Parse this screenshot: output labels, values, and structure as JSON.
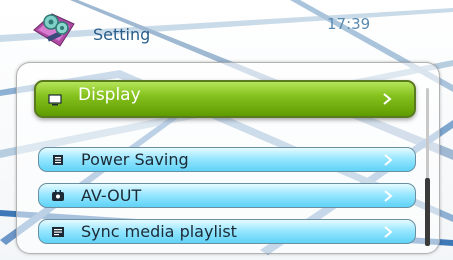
{
  "header": {
    "title": "Setting",
    "time": "17:39",
    "app_icon": "settings-gears-icon"
  },
  "menu": {
    "items": [
      {
        "label": "Display",
        "icon": "display-icon",
        "selected": true
      },
      {
        "label": "Power Saving",
        "icon": "power-saving-icon",
        "selected": false
      },
      {
        "label": "AV-OUT",
        "icon": "av-out-icon",
        "selected": false
      },
      {
        "label": "Sync media playlist",
        "icon": "playlist-icon",
        "selected": false
      }
    ]
  },
  "colors": {
    "selected_item": "#7ab51a",
    "normal_item": "#7fdcfb",
    "title_text": "#2a5d8a"
  }
}
